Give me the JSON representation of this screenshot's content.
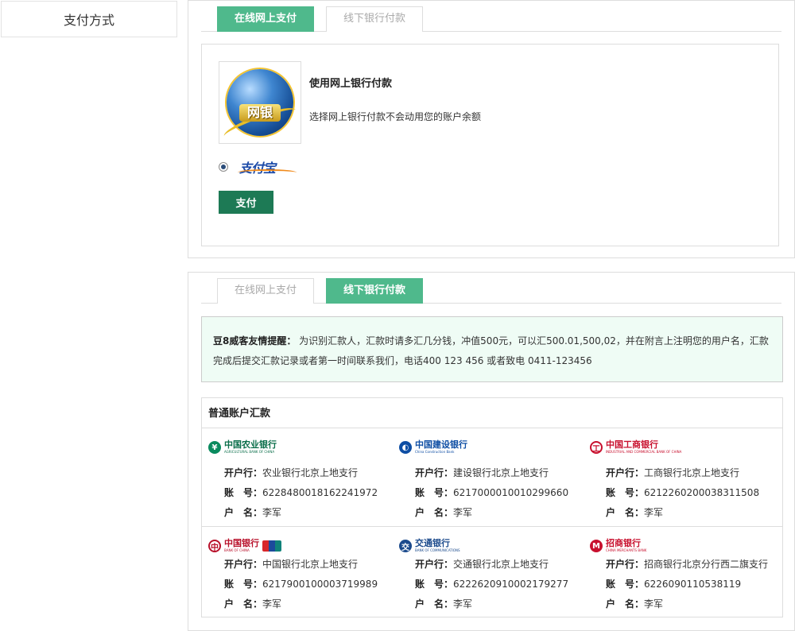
{
  "sidebar": {
    "title": "支付方式"
  },
  "panel1": {
    "tabs": [
      "在线网上支付",
      "线下银行付款"
    ],
    "active_tab": 0,
    "netbank_logo_text": "网银",
    "pay_title": "使用网上银行付款",
    "pay_desc": "选择网上银行付款不会动用您的账户余额",
    "alipay_label": "支付宝",
    "pay_button": "支付"
  },
  "panel2": {
    "tabs": [
      "在线网上支付",
      "线下银行付款"
    ],
    "active_tab": 1,
    "notice_bold": "豆8威客友情提醒：",
    "notice_text": " 为识别汇款人，汇款时请多汇几分钱，冲值500元，可以汇500.01,500,02，并在附言上注明您的用户名，汇款完成后提交汇款记录或者第一时间联系我们，电话400 123 456 或者致电 0411-123456",
    "accounts_title": "普通账户汇款",
    "labels": {
      "branch": "开户行：",
      "account": "账　号：",
      "name": "户　名："
    },
    "banks": [
      {
        "logo": "中国农业银行",
        "logo_sub": "AGRICULTURAL BANK OF CHINA",
        "color": "#0a8a5e",
        "branch": "农业银行北京上地支行",
        "account": "6228480018162241972",
        "holder": "李军"
      },
      {
        "logo": "中国建设银行",
        "logo_sub": "China Construction Bank",
        "color": "#0e4ea4",
        "branch": "建设银行北京上地支行",
        "account": "6217000010010299660",
        "holder": "李军"
      },
      {
        "logo": "中国工商银行",
        "logo_sub": "INDUSTRIAL AND COMMERCIAL BANK OF CHINA",
        "color": "#c8102e",
        "branch": "工商银行北京上地支行",
        "account": "6212260200038311508",
        "holder": "李军"
      },
      {
        "logo": "中国银行",
        "logo_sub": "BANK OF CHINA",
        "color": "#b8102a",
        "branch": "中国银行北京上地支行",
        "account": "6217900100003719989",
        "holder": "李军"
      },
      {
        "logo": "交通银行",
        "logo_sub": "BANK OF COMMUNICATIONS",
        "color": "#1b4a8c",
        "branch": "交通银行北京上地支行",
        "account": "6222620910002179277",
        "holder": "李军"
      },
      {
        "logo": "招商银行",
        "logo_sub": "CHINA MERCHANTS BANK",
        "color": "#c8102e",
        "branch": "招商银行北京分行西二旗支行",
        "account": "6226090110538119",
        "holder": "李军"
      }
    ]
  }
}
